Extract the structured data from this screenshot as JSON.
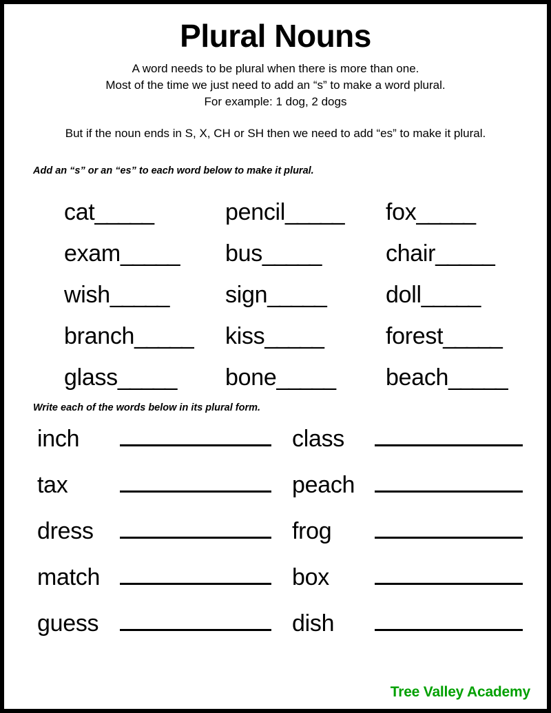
{
  "page": {
    "title": "Plural Nouns",
    "intro_lines": [
      "A word needs to be plural when there is more than one.",
      "Most of the time we just need to add an “s” to make a word plural.",
      "For example: 1 dog, 2 dogs"
    ],
    "rule_note": "But if the noun ends in S, X, CH or SH then we need to add “es” to make it plural."
  },
  "exercise1": {
    "instruction": "Add an “s” or an “es” to each word below to make it plural.",
    "blank": "_____",
    "columns": [
      {
        "words": [
          "cat",
          "exam",
          "wish",
          "branch",
          "glass"
        ]
      },
      {
        "words": [
          "pencil",
          "bus",
          "sign",
          "kiss",
          "bone"
        ]
      },
      {
        "words": [
          "fox",
          "chair",
          "doll",
          "forest",
          "beach"
        ]
      }
    ]
  },
  "exercise2": {
    "instruction": "Write each of the words below in its plural form.",
    "columns": [
      {
        "words": [
          "inch",
          "tax",
          "dress",
          "match",
          "guess"
        ]
      },
      {
        "words": [
          "class",
          "peach",
          "frog",
          "box",
          "dish"
        ]
      }
    ]
  },
  "footer": {
    "brand": "Tree Valley Academy",
    "brand_color": "#00A000"
  }
}
